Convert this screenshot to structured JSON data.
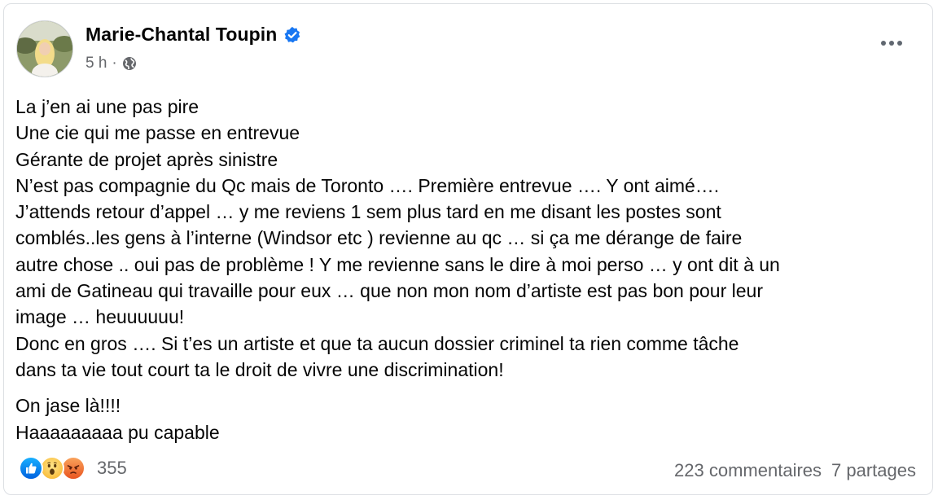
{
  "post": {
    "author": "Marie-Chantal Toupin",
    "time": "5 h",
    "separator": "·",
    "privacy_icon": "globe-icon",
    "verified_icon": "verified-badge-icon",
    "more_icon": "more-options-icon",
    "lines_para1": [
      "La j’en ai une pas pire",
      "Une cie qui me passe en entrevue",
      "Gérante de projet après sinistre",
      "N’est pas compagnie du Qc mais de Toronto …. Première entrevue …. Y ont aimé….",
      "J’attends retour d’appel … y me reviens 1 sem plus tard en me disant les postes sont",
      "comblés..les gens à l’interne (Windsor etc ) revienne au qc … si ça me dérange de faire",
      "autre chose .. oui pas de problème ! Y me revienne sans le dire à moi perso … y ont dit à un",
      "ami de Gatineau qui travaille pour eux … que non mon nom d’artiste est pas bon pour leur",
      "image … heuuuuuu!",
      "Donc en gros …. Si t’es un artiste et que ta aucun dossier criminel ta rien comme tâche",
      "dans ta vie tout court ta le droit de vivre une discrimination!"
    ],
    "lines_para2": [
      "On jase là!!!!",
      "Haaaaaaaaa pu capable"
    ],
    "reactions": {
      "icons": [
        "like-icon",
        "wow-icon",
        "angry-icon"
      ],
      "count": "355"
    },
    "comments": "223 commentaires",
    "shares": "7 partages"
  },
  "colors": {
    "text": "#050505",
    "secondary": "#65676b",
    "verified": "#1877f2",
    "border": "#dcdfe3"
  }
}
